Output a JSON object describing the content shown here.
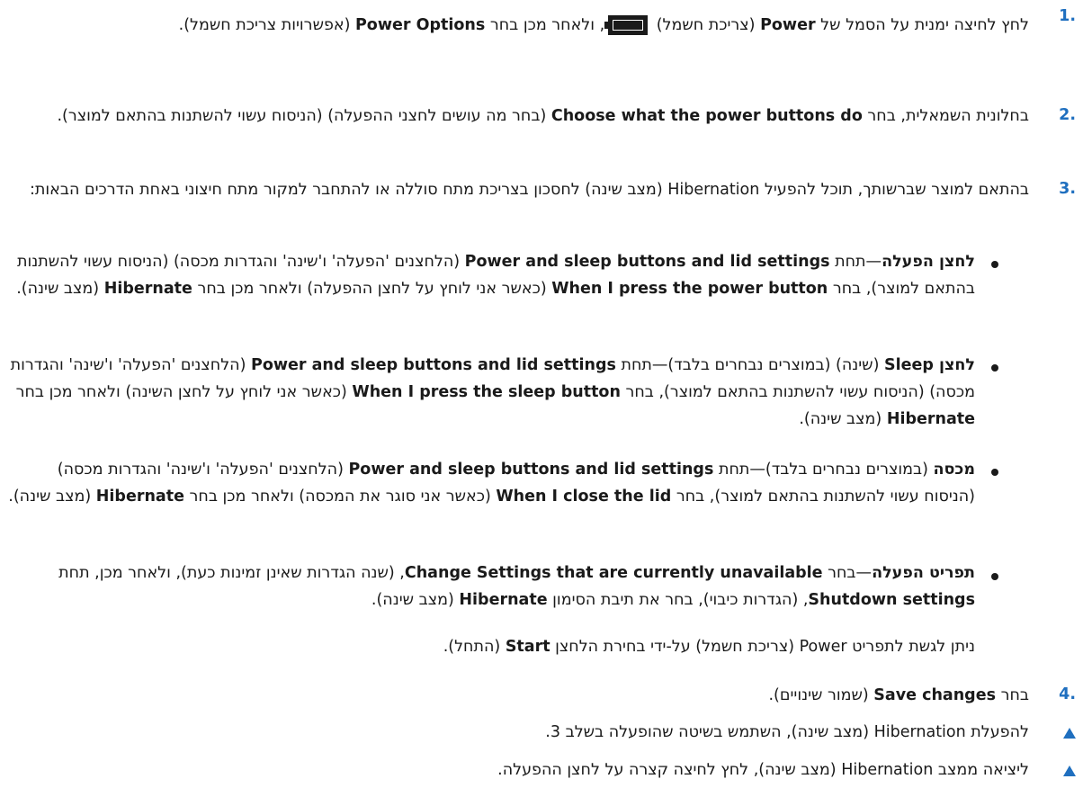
{
  "steps": [
    {
      "marker": "1.",
      "parts": [
        {
          "t": "לחץ לחיצה ימנית על הסמל של "
        },
        {
          "t": "Power",
          "b": true
        },
        {
          "t": " (צריכת חשמל) "
        },
        {
          "icon": "battery-icon"
        },
        {
          "t": ", ולאחר מכן בחר "
        },
        {
          "t": "Power Options",
          "b": true
        },
        {
          "t": " (אפשרויות צריכת חשמל)."
        }
      ]
    },
    {
      "marker": "2.",
      "parts": [
        {
          "t": "בחלונית השמאלית, בחר "
        },
        {
          "t": "Choose what the power buttons do",
          "b": true
        },
        {
          "t": " (בחר מה עושים לחצני ההפעלה) (הניסוח עשוי להשתנות בהתאם למוצר)."
        }
      ]
    },
    {
      "marker": "3.",
      "parts": [
        {
          "t": "בהתאם למוצר שברשותך, תוכל להפעיל Hibernation (מצב שינה) לחסכון בצריכת מתח סוללה או להתחבר למקור מתח חיצוני באחת הדרכים הבאות:"
        }
      ]
    }
  ],
  "bullets": [
    {
      "parts": [
        {
          "t": "לחצן הפעלה",
          "b": true
        },
        {
          "t": "—תחת "
        },
        {
          "t": "Power and sleep buttons and lid settings",
          "b": true
        },
        {
          "t": " (הלחצנים 'הפעלה' ו'שינה' והגדרות מכסה) (הניסוח עשוי להשתנות בהתאם למוצר), בחר "
        },
        {
          "t": "When I press the power button",
          "b": true
        },
        {
          "t": " (כאשר אני לוחץ על לחצן ההפעלה) ולאחר מכן בחר "
        },
        {
          "t": "Hibernate",
          "b": true
        },
        {
          "t": " (מצב שינה)."
        }
      ]
    },
    {
      "parts": [
        {
          "t": "לחצן Sleep",
          "b": true
        },
        {
          "t": " (שינה) (במוצרים נבחרים בלבד)—תחת "
        },
        {
          "t": "Power and sleep buttons and lid settings",
          "b": true
        },
        {
          "t": " (הלחצנים 'הפעלה' ו'שינה' והגדרות מכסה) (הניסוח עשוי להשתנות בהתאם למוצר), בחר "
        },
        {
          "t": "When I press the sleep button",
          "b": true
        },
        {
          "t": " (כאשר אני לוחץ על לחצן השינה) ולאחר מכן בחר "
        },
        {
          "t": "Hibernate",
          "b": true
        },
        {
          "t": " (מצב שינה)."
        }
      ]
    },
    {
      "parts": [
        {
          "t": "מכסה",
          "b": true
        },
        {
          "t": " (במוצרים נבחרים בלבד)—תחת "
        },
        {
          "t": "Power and sleep buttons and lid settings",
          "b": true
        },
        {
          "t": " (הלחצנים 'הפעלה' ו'שינה' והגדרות מכסה) (הניסוח עשוי להשתנות בהתאם למוצר), בחר "
        },
        {
          "t": "When I close the lid",
          "b": true
        },
        {
          "t": " (כאשר אני סוגר את המכסה) ולאחר מכן בחר "
        },
        {
          "t": "Hibernate",
          "b": true
        },
        {
          "t": " (מצב שינה)."
        }
      ]
    },
    {
      "parts": [
        {
          "t": "תפריט הפעלה",
          "b": true
        },
        {
          "t": "—בחר "
        },
        {
          "t": "Change Settings that are currently unavailable",
          "b": true
        },
        {
          "t": ", (שנה הגדרות שאינן זמינות כעת), ולאחר מכן, תחת "
        },
        {
          "t": "Shutdown settings",
          "b": true
        },
        {
          "t": ", (הגדרות כיבוי), בחר את תיבת הסימון "
        },
        {
          "t": "Hibernate",
          "b": true
        },
        {
          "t": " (מצב שינה)."
        }
      ]
    }
  ],
  "note": {
    "parts": [
      {
        "t": "ניתן לגשת לתפריט Power (צריכת חשמל) על-ידי בחירת הלחצן "
      },
      {
        "t": "Start",
        "b": true
      },
      {
        "t": " (התחל)."
      }
    ]
  },
  "step4": {
    "marker": "4.",
    "parts": [
      {
        "t": "בחר "
      },
      {
        "t": "Save changes",
        "b": true
      },
      {
        "t": " (שמור שינויים)."
      }
    ]
  },
  "results": [
    {
      "t": "להפעלת Hibernation (מצב שינה), השתמש בשיטה שהופעלה בשלב 3."
    },
    {
      "t": "ליציאה ממצב Hibernation (מצב שינה), לחץ לחיצה קצרה על לחצן ההפעלה."
    }
  ],
  "colors": {
    "accent": "#1f6fbf",
    "text": "#1a1a1a"
  }
}
